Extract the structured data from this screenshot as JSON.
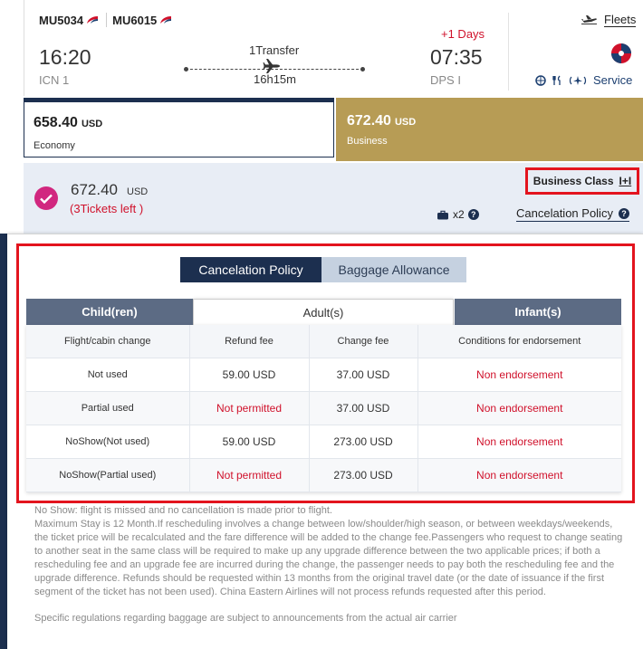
{
  "header": {
    "flight_numbers": [
      "MU5034",
      "MU6015"
    ],
    "departure_time": "16:20",
    "departure_airport": "ICN 1",
    "transfer_label": "1Transfer",
    "duration": "16h15m",
    "day_offset": "+1 Days",
    "arrival_time": "07:35",
    "arrival_airport": "DPS I",
    "fleets_label": "Fleets",
    "service_label": "Service"
  },
  "fares": {
    "economy": {
      "price": "658.40",
      "currency": "USD",
      "class_name": "Economy"
    },
    "business": {
      "price": "672.40",
      "currency": "USD",
      "class_name": "Business"
    }
  },
  "selected": {
    "price": "672.40",
    "currency": "USD",
    "tickets_left": "(3Tickets left )",
    "class_link": "Business Class",
    "class_icon_text": "I+I",
    "baggage_count": "x2",
    "cancel_policy_link": "Cancelation Policy"
  },
  "popup": {
    "tabs": {
      "active": "Cancelation Policy",
      "inactive": "Baggage Allowance"
    },
    "passenger_tabs": {
      "child": "Child(ren)",
      "adult": "Adult(s)",
      "infant": "Infant(s)"
    },
    "columns": [
      "Flight/cabin change",
      "Refund fee",
      "Change fee",
      "Conditions for endorsement"
    ],
    "rows": [
      {
        "label": "Not used",
        "refund": "59.00 USD",
        "change": "37.00 USD",
        "endorsement": "Non endorsement"
      },
      {
        "label": "Partial used",
        "refund": "Not permitted",
        "change": "37.00 USD",
        "endorsement": "Non endorsement"
      },
      {
        "label": "NoShow(Not used)",
        "refund": "59.00 USD",
        "change": "273.00 USD",
        "endorsement": "Non endorsement"
      },
      {
        "label": "NoShow(Partial used)",
        "refund": "Not permitted",
        "change": "273.00 USD",
        "endorsement": "Non endorsement"
      }
    ],
    "notes": {
      "noshow": "No Show: flight is missed and no cancellation is made prior to flight.",
      "maxstay": "Maximum Stay is 12 Month.If rescheduling involves a change between low/shoulder/high season, or between weekdays/weekends, the ticket price will be recalculated and the fare difference will be added to the change fee.Passengers who request to change seating to another seat in the same class will be required to make up any upgrade difference between the two applicable prices; if both a rescheduling fee and an upgrade fee are incurred during the change, the passenger needs to pay both the rescheduling fee and the upgrade difference. Refunds should be requested within 13 months from the original travel date (or the date of issuance if the first segment of the ticket has not been used). China Eastern Airlines will not process refunds requested after this period.",
      "baggage": "Specific regulations regarding baggage are subject to announcements from the actual air carrier"
    }
  },
  "colors": {
    "navy": "#1c2f4f",
    "gold": "#b79c55",
    "red": "#d0112b",
    "highlight": "#e3141e",
    "pink_check": "#d1277f",
    "slate": "#5c6b84"
  }
}
